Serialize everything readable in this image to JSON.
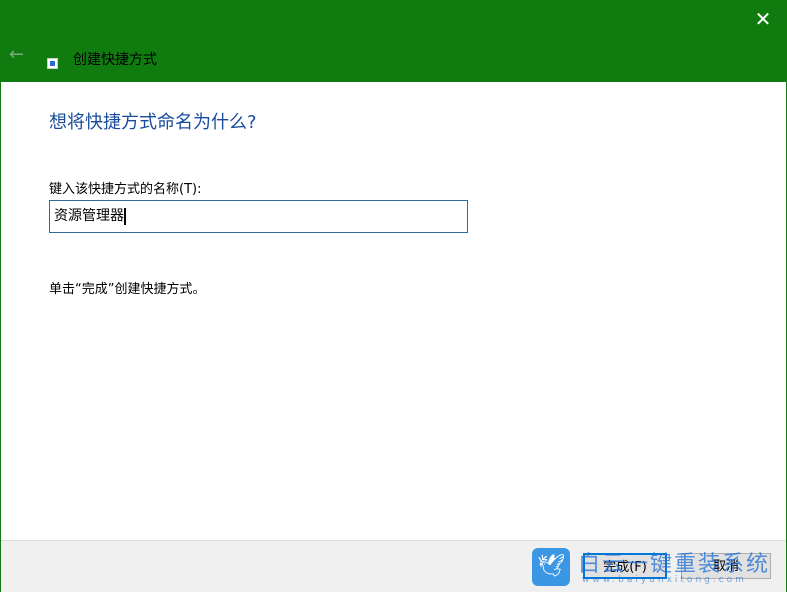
{
  "window": {
    "title": "创建快捷方式",
    "close_glyph": "✕",
    "back_glyph": "←"
  },
  "content": {
    "heading": "想将快捷方式命名为什么?",
    "name_label": "键入该快捷方式的名称(T):",
    "name_value": "资源管理器",
    "hint": "单击“完成”创建快捷方式。"
  },
  "footer": {
    "finish": "完成(F)",
    "cancel": "取消"
  },
  "watermark": {
    "text": "白云一键重装系统",
    "url": "www.baiyunxitong.com"
  }
}
